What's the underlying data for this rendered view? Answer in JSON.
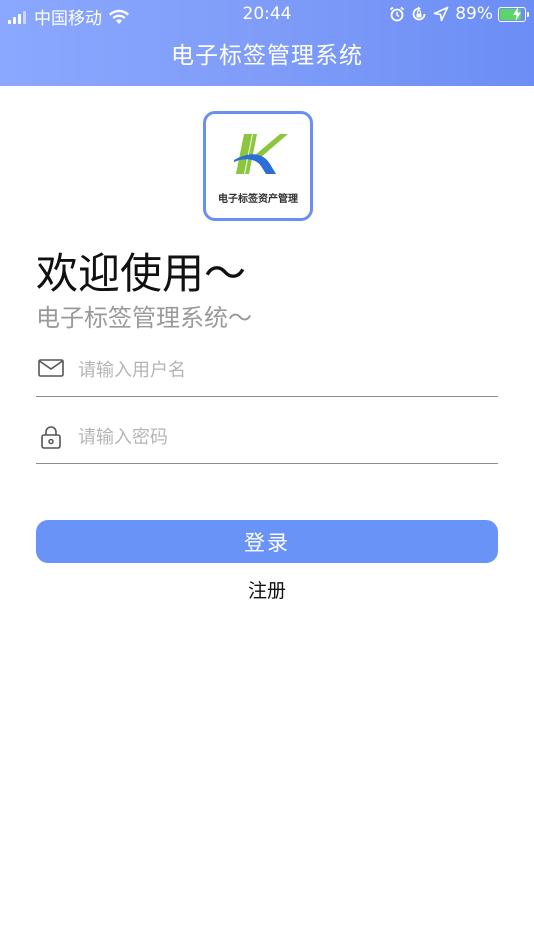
{
  "status_bar": {
    "carrier": "中国移动",
    "time": "20:44",
    "battery": "89%"
  },
  "header": {
    "title": "电子标签管理系统"
  },
  "logo": {
    "text": "电子标签资产管理",
    "colors": {
      "green": "#8cc63f",
      "blue": "#2b6fd6"
    }
  },
  "welcome": {
    "title": "欢迎使用～",
    "subtitle": "电子标签管理系统～"
  },
  "form": {
    "username_placeholder": "请输入用户名",
    "password_placeholder": "请输入密码",
    "login_label": "登录",
    "register_label": "注册"
  },
  "colors": {
    "accent": "#6a93f7",
    "header_gradient_start": "#8aa8ff",
    "header_gradient_end": "#6b8df5"
  }
}
